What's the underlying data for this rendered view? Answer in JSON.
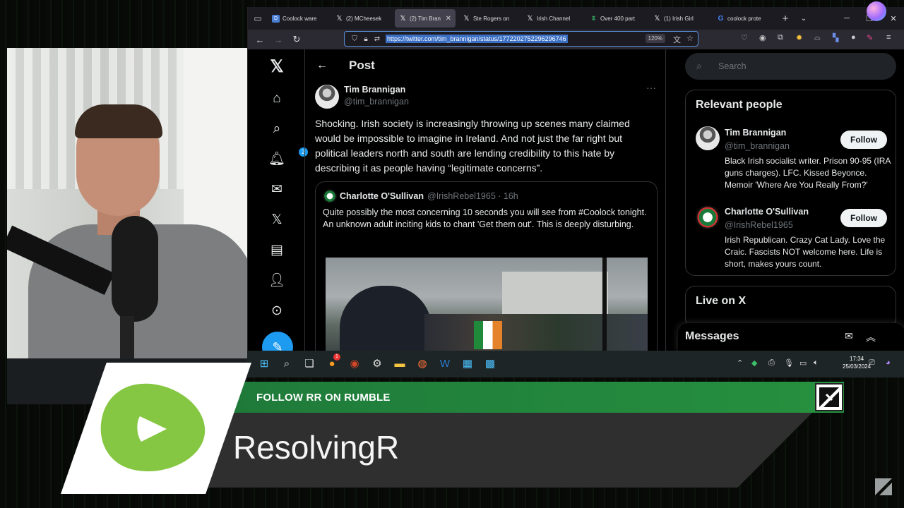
{
  "browser": {
    "tabs": [
      {
        "label": "Coolock ware",
        "icon": "doc-icon"
      },
      {
        "label": "(2) MCheesek",
        "icon": "x-icon"
      },
      {
        "label": "(2) Tim Bran",
        "icon": "x-icon",
        "active": true
      },
      {
        "label": "Ste Rogers on",
        "icon": "x-icon"
      },
      {
        "label": "Irish Channel",
        "icon": "x-icon"
      },
      {
        "label": "Over 400 part",
        "icon": "tracker-icon"
      },
      {
        "label": "(1) Irish Girl",
        "icon": "x-icon"
      },
      {
        "label": "coolock prote",
        "icon": "google-icon"
      }
    ],
    "url": "https://twitter.com/tim_brannigan/status/1772202752296296746",
    "zoom": "120%"
  },
  "x": {
    "nav_badge": "2",
    "header_title": "Post",
    "author": {
      "name": "Tim Brannigan",
      "handle": "@tim_brannigan"
    },
    "tweet_text": "Shocking. Irish society is increasingly throwing up scenes many claimed would be impossible to imagine in Ireland. And not just the far right but political leaders north and south are lending credibility to this hate by describing it as people having “legitimate concerns”.",
    "quote": {
      "name": "Charlotte O'Sullivan",
      "meta": "@IrishRebel1965 · 16h",
      "text": "Quite possibly the most concerning 10 seconds you will see from #Coolock tonight. An unknown adult inciting kids to chant 'Get them out'. This is deeply disturbing."
    },
    "search_placeholder": "Search",
    "relevant": {
      "title": "Relevant people",
      "people": [
        {
          "name": "Tim Brannigan",
          "handle": "@tim_brannigan",
          "bio": "Black Irish socialist writer. Prison 90-95 (IRA guns charges). LFC. Kissed Beyonce. Memoir 'Where Are You Really From?'",
          "follow": "Follow"
        },
        {
          "name": "Charlotte O'Sullivan",
          "handle": "@IrishRebel1965",
          "bio": "Irish Republican. Crazy Cat Lady. Love the Craic. Fascists NOT welcome here. Life is short, makes yours count.",
          "follow": "Follow"
        }
      ]
    },
    "live_title": "Live on X",
    "messages_title": "Messages"
  },
  "taskbar": {
    "time": "17:34",
    "date": "25/03/2024",
    "notification_badge": "1"
  },
  "overlay": {
    "banner": "FOLLOW RR ON RUMBLE",
    "channel": "ResolvingR",
    "brand_green": "#85c742",
    "bar_green": "#26913f"
  }
}
